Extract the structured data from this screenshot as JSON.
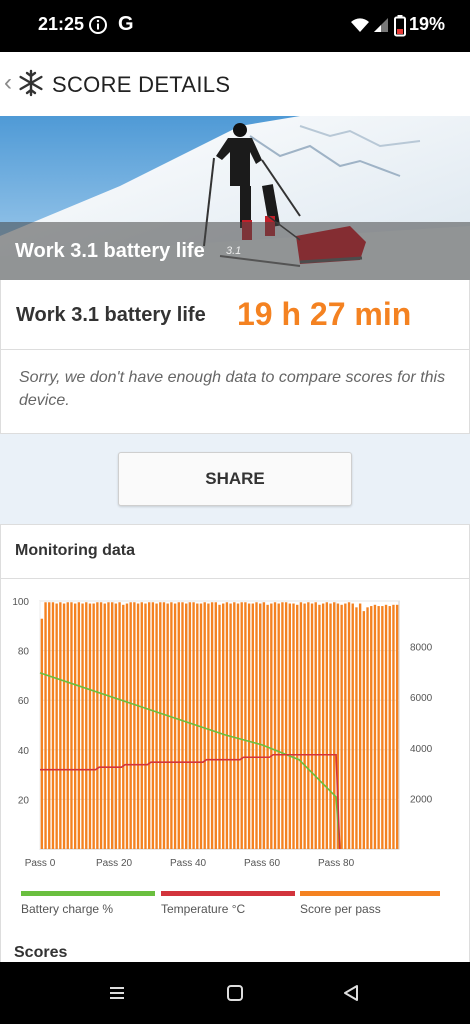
{
  "status": {
    "time": "21:25",
    "g": "G",
    "battery": "19%"
  },
  "appbar": {
    "back": "‹",
    "title": "SCORE DETAILS"
  },
  "hero": {
    "title": "Work 3.1 battery life",
    "version": "3.1"
  },
  "score": {
    "label": "Work 3.1 battery life",
    "value": "19 h 27 min"
  },
  "message": "Sorry, we don't have enough data to compare scores for this device.",
  "share_label": "SHARE",
  "monitoring": {
    "title": "Monitoring data"
  },
  "scores_heading": "Scores",
  "colors": {
    "accent": "#f48221",
    "battery": "#6abf3f",
    "temperature": "#d2343c",
    "score": "#f48221"
  },
  "chart_data": {
    "type": "bar",
    "x_ticks": [
      "Pass 0",
      "Pass 20",
      "Pass 40",
      "Pass 60",
      "Pass 80"
    ],
    "xlim": [
      0,
      97
    ],
    "y_left_ticks": [
      "20",
      "40",
      "60",
      "80",
      "100"
    ],
    "y_left_lim": [
      0,
      100
    ],
    "y_right_ticks": [
      "2000",
      "4000",
      "6000",
      "8000"
    ],
    "y_right_lim": [
      0,
      9800
    ],
    "grid": true,
    "legend_position": "bottom",
    "series": [
      {
        "name": "Battery charge %",
        "type": "line",
        "axis": "left",
        "x": [
          0,
          10,
          20,
          30,
          40,
          50,
          60,
          70,
          80,
          81
        ],
        "y": [
          71,
          66,
          61,
          56,
          51,
          46,
          42,
          36,
          21,
          0
        ]
      },
      {
        "name": "Temperature °C",
        "type": "line",
        "axis": "left",
        "x": [
          0,
          15,
          16,
          22,
          23,
          29,
          30,
          44,
          45,
          54,
          55,
          62,
          63,
          80,
          81
        ],
        "y": [
          32,
          32,
          33,
          33,
          34,
          34,
          35,
          35,
          36,
          36,
          37,
          37,
          38,
          38,
          0
        ]
      },
      {
        "name": "Score per pass",
        "type": "bar",
        "axis": "right",
        "count": 97,
        "start": 0,
        "typical": 9700,
        "first": 9100,
        "values_note_low": [],
        "values": [
          9100,
          9750,
          9750,
          9750,
          9700,
          9750,
          9700,
          9750,
          9750,
          9700,
          9750,
          9700,
          9750,
          9700,
          9700,
          9750,
          9750,
          9700,
          9750,
          9750,
          9700,
          9750,
          9650,
          9700,
          9750,
          9750,
          9700,
          9750,
          9700,
          9750,
          9750,
          9700,
          9750,
          9750,
          9700,
          9750,
          9700,
          9750,
          9750,
          9700,
          9750,
          9750,
          9700,
          9700,
          9750,
          9700,
          9750,
          9750,
          9650,
          9700,
          9750,
          9700,
          9750,
          9700,
          9750,
          9750,
          9700,
          9700,
          9750,
          9700,
          9750,
          9650,
          9700,
          9750,
          9700,
          9750,
          9750,
          9700,
          9700,
          9650,
          9750,
          9700,
          9750,
          9700,
          9750,
          9650,
          9700,
          9750,
          9700,
          9750,
          9700,
          9650,
          9700,
          9750,
          9700,
          9550,
          9700,
          9400,
          9550,
          9600,
          9650,
          9600,
          9600,
          9650,
          9600,
          9650,
          9650
        ]
      }
    ]
  }
}
